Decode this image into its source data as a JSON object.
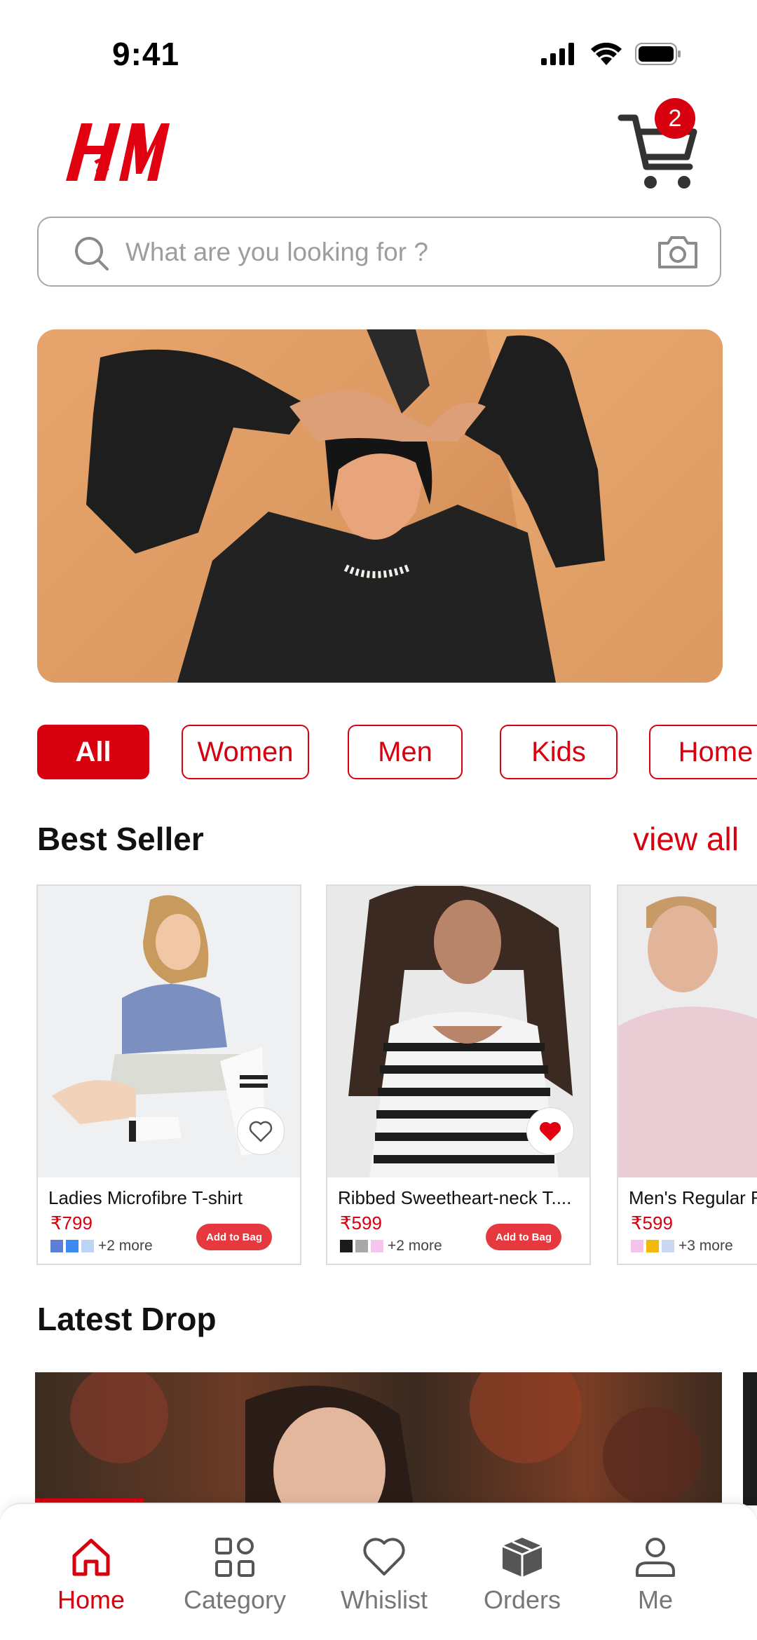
{
  "status_bar": {
    "time": "9:41"
  },
  "header": {
    "cart_count": "2"
  },
  "search": {
    "placeholder": "What are you looking for ?"
  },
  "categories": [
    "All",
    "Women",
    "Men",
    "Kids",
    "Home"
  ],
  "best_seller": {
    "title": "Best Seller",
    "view_all": "view all",
    "products": [
      {
        "name": "Ladies Microfibre T-shirt",
        "price": "₹799",
        "more_colors": "+2 more",
        "add_label": "Add to Bag",
        "wishlisted": false,
        "swatches": [
          "#5b7fd6",
          "#3d8bf0",
          "#bcd4f5"
        ]
      },
      {
        "name": "Ribbed Sweetheart-neck T....",
        "price": "₹599",
        "more_colors": "+2 more",
        "add_label": "Add to Bag",
        "wishlisted": true,
        "swatches": [
          "#1b1b1b",
          "#a8a8a8",
          "#f7c6ef"
        ]
      },
      {
        "name": "Men's Regular F",
        "price": "₹599",
        "more_colors": "+3 more",
        "add_label": "",
        "wishlisted": false,
        "swatches": [
          "#f5c2ec",
          "#f0b90b",
          "#c9d7f2"
        ]
      }
    ]
  },
  "latest_drop": {
    "title": "Latest Drop"
  },
  "bottom_nav": [
    {
      "label": "Home",
      "icon": "home-icon",
      "active": true
    },
    {
      "label": "Category",
      "icon": "grid-icon",
      "active": false
    },
    {
      "label": "Whislist",
      "icon": "heart-icon",
      "active": false
    },
    {
      "label": "Orders",
      "icon": "box-icon",
      "active": false
    },
    {
      "label": "Me",
      "icon": "user-icon",
      "active": false
    }
  ],
  "colors": {
    "brand": "#d6000f",
    "add_button": "#e5393f",
    "muted": "#777777"
  }
}
